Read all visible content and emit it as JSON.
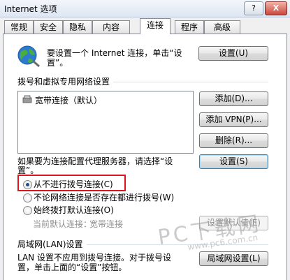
{
  "window": {
    "title": "Internet 选项",
    "help_label": "?",
    "close_label": "X"
  },
  "tabs": [
    "常规",
    "安全",
    "隐私",
    "内容",
    "连接",
    "程序",
    "高级"
  ],
  "active_tab": "连接",
  "setup": {
    "text_line1": "要设置一个 Internet 连接，单击“设",
    "text_line2": "置”。",
    "button": "设置(U)"
  },
  "dialup": {
    "section_title": "拨号和虚拟专用网络设置",
    "items": [
      "宽带连接（默认）"
    ],
    "add_button": "添加(D)...",
    "add_vpn_button": "添加 VPN(P)...",
    "delete_button": "删除(R)...",
    "proxy_text_line1": "如果要为连接配置代理服务器，请选择“设",
    "proxy_text_line2": "置”。",
    "settings_button": "设置(S)"
  },
  "dial_options": [
    {
      "label": "从不进行拨号连接(C)",
      "checked": true
    },
    {
      "label": "不论网络连接是否存在都进行拨号(W)",
      "checked": false
    },
    {
      "label": "始终拨打默认连接(O)",
      "checked": false
    }
  ],
  "current_default": {
    "label": "当前默认连接：",
    "value": "宽带连接",
    "button": "设置默认值(E)"
  },
  "lan": {
    "section_title": "局域网(LAN)设置",
    "text_line1": "LAN 设置不应用到拨号连接。对于拨号设",
    "text_line2": "置，单击上面的“设置”按钮。",
    "button": "局域网设置(L)"
  },
  "watermark": {
    "main": "PC下载网",
    "url": "www.pc6.com.cn"
  },
  "colors": {
    "highlight_border": "#d9151d",
    "window_bg": "#f0f0f0"
  }
}
